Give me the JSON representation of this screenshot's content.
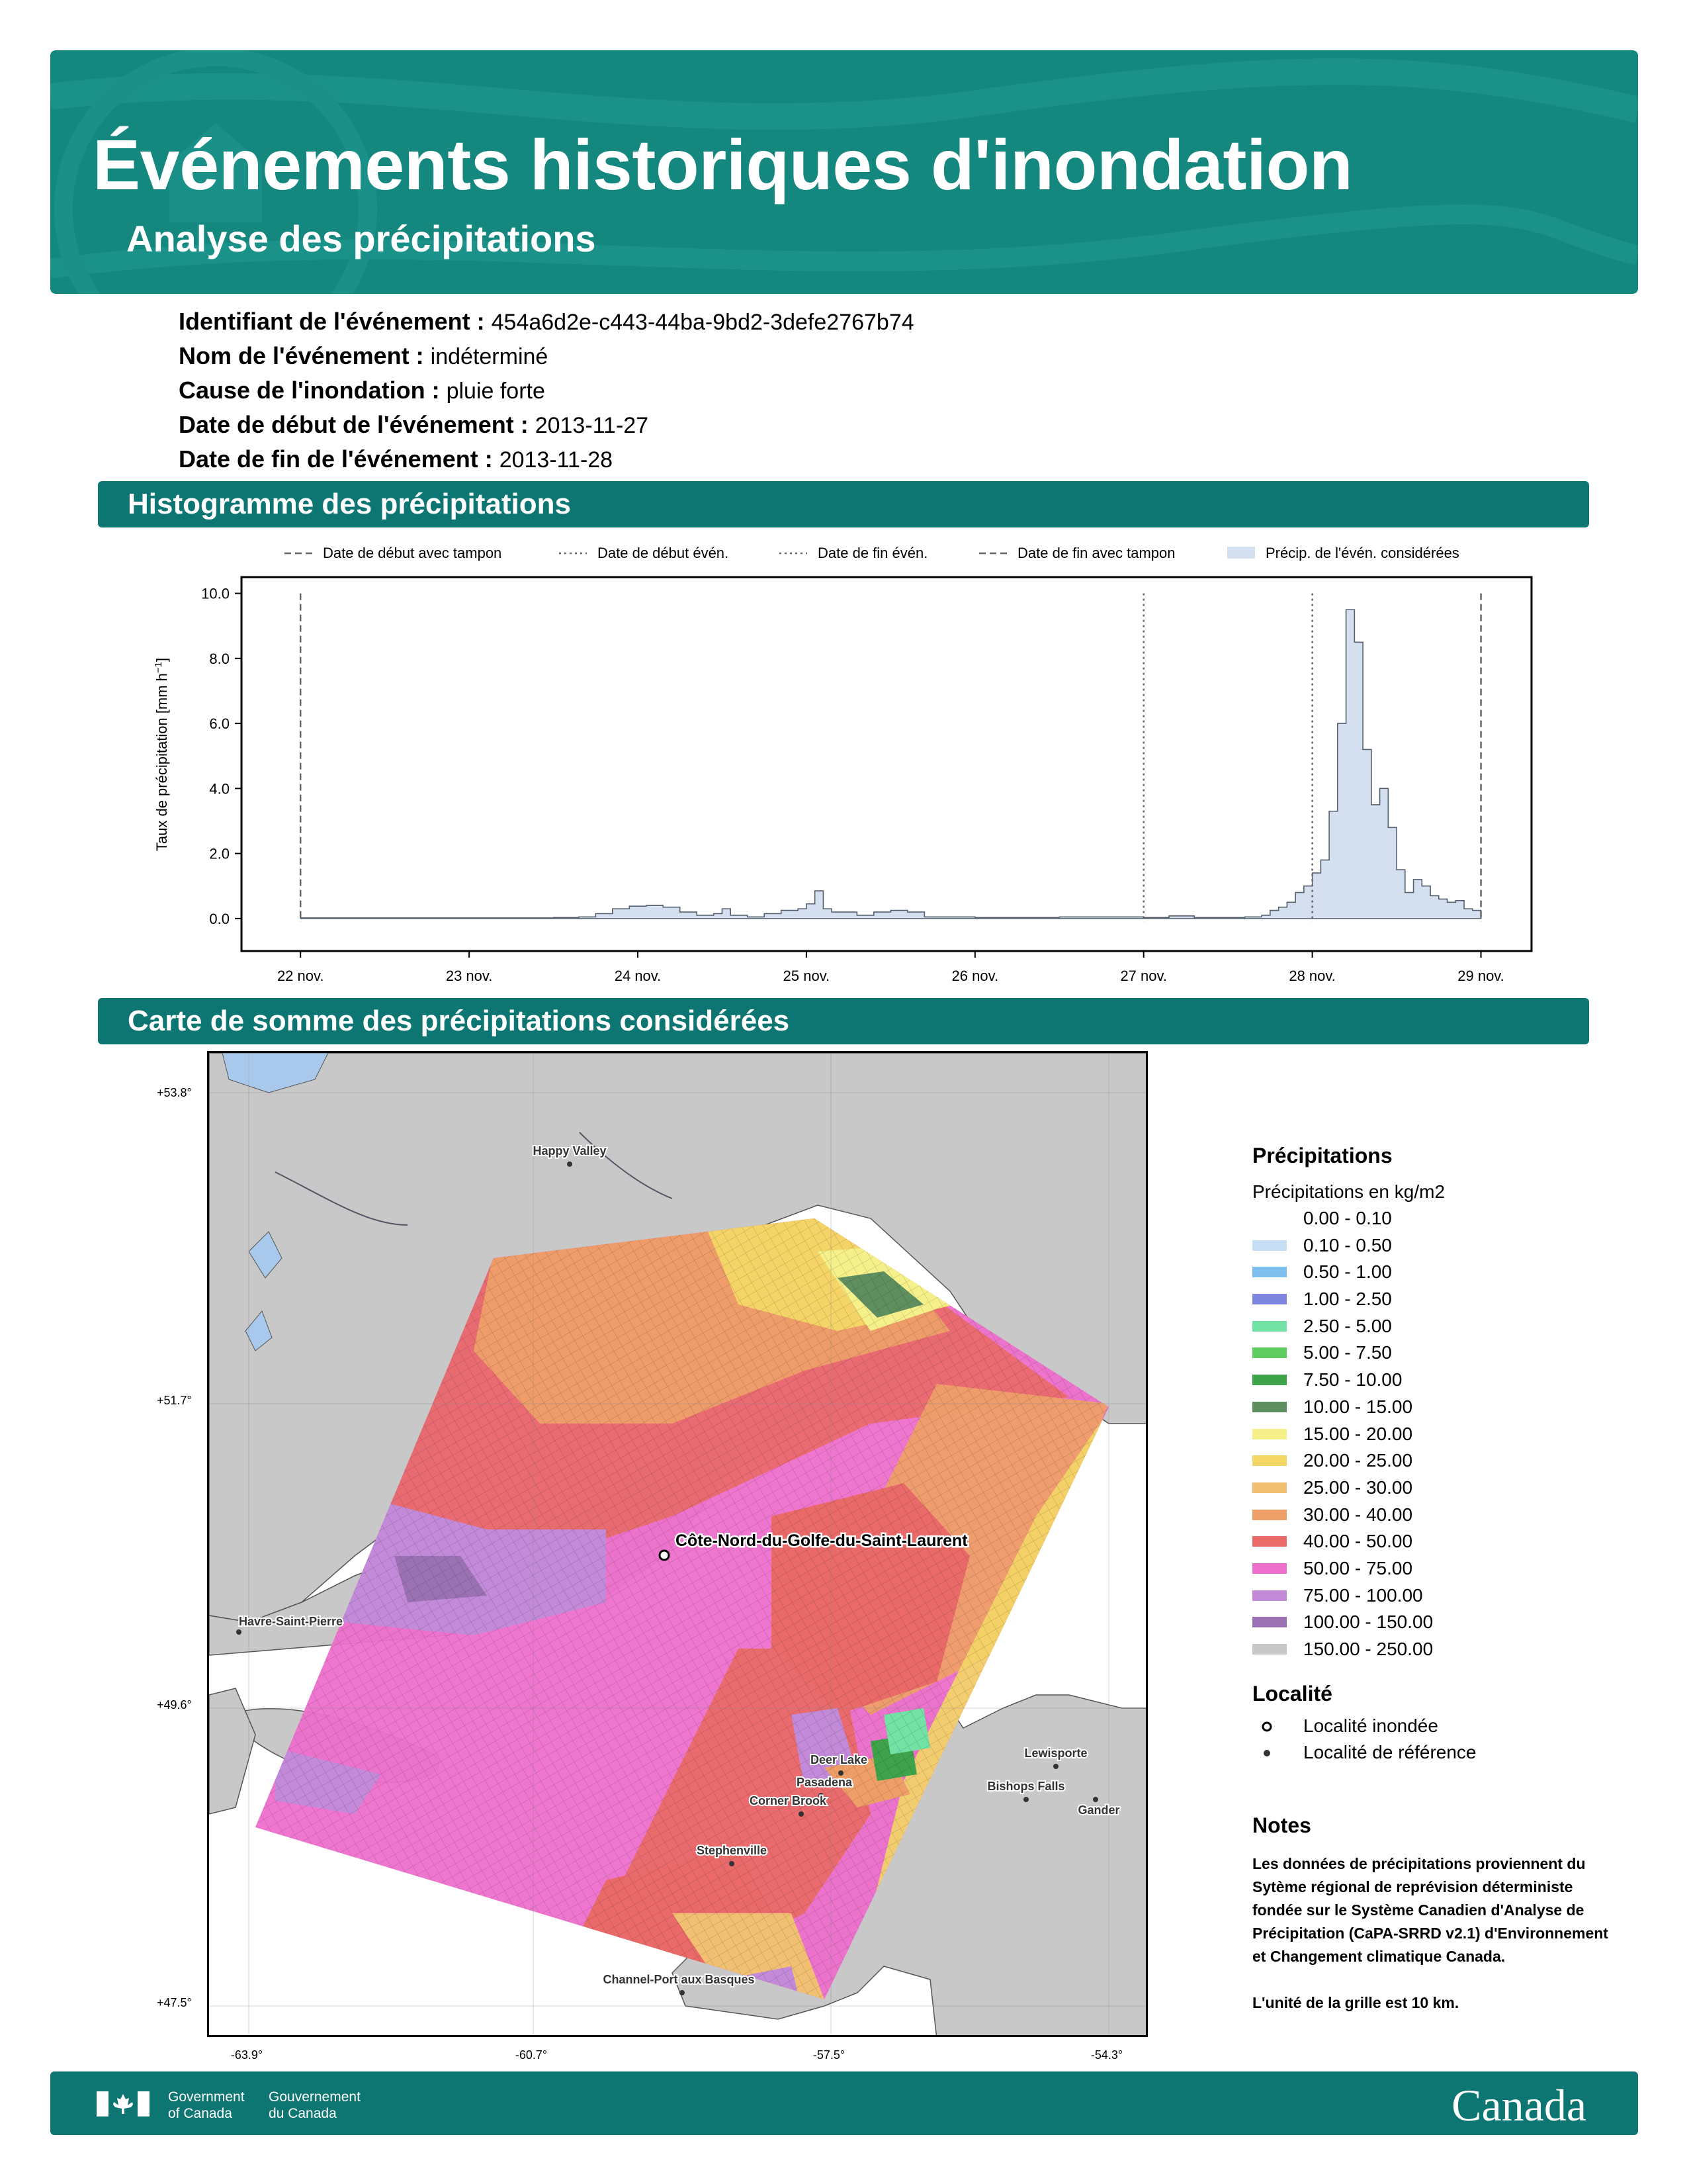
{
  "header": {
    "title": "Événements historiques d'inondation",
    "subtitle": "Analyse des précipitations"
  },
  "event": {
    "id_label": "Identifiant de l'événement :",
    "id_value": "454a6d2e-c443-44ba-9bd2-3defe2767b74",
    "name_label": "Nom de l'événement :",
    "name_value": "indéterminé",
    "cause_label": "Cause de l'inondation :",
    "cause_value": "pluie forte",
    "start_label": "Date de début de l'événement :",
    "start_value": "2013-11-27",
    "end_label": "Date de fin de l'événement :",
    "end_value": "2013-11-28"
  },
  "sections": {
    "histogram": "Histogramme des précipitations",
    "map": "Carte de somme des précipitations considérées"
  },
  "chart_data": {
    "type": "area",
    "ylabel": "Taux de précipitation [mm h",
    "ylabel_sup": "−1",
    "ylabel_end": "]",
    "ylim": [
      -1.0,
      10.5
    ],
    "yticks": [
      0.0,
      2.0,
      4.0,
      6.0,
      8.0,
      10.0
    ],
    "ytick_labels": [
      "0.0",
      "2.0",
      "4.0",
      "6.0",
      "8.0",
      "10.0"
    ],
    "xlim": [
      -0.35,
      7.3
    ],
    "xticks": [
      0,
      1,
      2,
      3,
      4,
      5,
      6,
      7
    ],
    "xtick_labels": [
      "22 nov.",
      "23 nov.",
      "24 nov.",
      "25 nov.",
      "26 nov.",
      "27 nov.",
      "28 nov.",
      "29 nov."
    ],
    "legend_position": "top",
    "legend": [
      {
        "label": "Date de début avec tampon",
        "style": "dashed"
      },
      {
        "label": "Date de début évén.",
        "style": "dotted"
      },
      {
        "label": "Date de fin évén.",
        "style": "dotted"
      },
      {
        "label": "Date de fin avec tampon",
        "style": "dashed"
      },
      {
        "label": "Précip. de l'évén. considérées",
        "style": "fill"
      }
    ],
    "vlines": [
      {
        "x": 0,
        "style": "dashed"
      },
      {
        "x": 5,
        "style": "dotted"
      },
      {
        "x": 6,
        "style": "dotted"
      },
      {
        "x": 7,
        "style": "dashed"
      }
    ],
    "fill_color": "#d4dff0",
    "series": [
      {
        "points": [
          [
            0.0,
            0.02
          ],
          [
            1.0,
            0.02
          ],
          [
            1.5,
            0.03
          ],
          [
            1.65,
            0.05
          ],
          [
            1.75,
            0.15
          ],
          [
            1.85,
            0.3
          ],
          [
            1.95,
            0.38
          ],
          [
            2.05,
            0.4
          ],
          [
            2.15,
            0.35
          ],
          [
            2.25,
            0.2
          ],
          [
            2.35,
            0.1
          ],
          [
            2.45,
            0.15
          ],
          [
            2.5,
            0.3
          ],
          [
            2.55,
            0.1
          ],
          [
            2.65,
            0.05
          ],
          [
            2.75,
            0.15
          ],
          [
            2.85,
            0.25
          ],
          [
            2.95,
            0.3
          ],
          [
            3.0,
            0.45
          ],
          [
            3.05,
            0.85
          ],
          [
            3.1,
            0.3
          ],
          [
            3.15,
            0.2
          ],
          [
            3.25,
            0.2
          ],
          [
            3.3,
            0.1
          ],
          [
            3.4,
            0.2
          ],
          [
            3.5,
            0.25
          ],
          [
            3.6,
            0.2
          ],
          [
            3.7,
            0.05
          ],
          [
            4.0,
            0.03
          ],
          [
            4.5,
            0.05
          ],
          [
            4.8,
            0.05
          ],
          [
            5.0,
            0.03
          ],
          [
            5.15,
            0.08
          ],
          [
            5.3,
            0.03
          ],
          [
            5.6,
            0.05
          ],
          [
            5.7,
            0.1
          ],
          [
            5.75,
            0.25
          ],
          [
            5.8,
            0.35
          ],
          [
            5.85,
            0.5
          ],
          [
            5.9,
            0.8
          ],
          [
            5.95,
            1.0
          ],
          [
            6.0,
            1.4
          ],
          [
            6.05,
            1.8
          ],
          [
            6.1,
            3.3
          ],
          [
            6.15,
            6.0
          ],
          [
            6.2,
            9.5
          ],
          [
            6.25,
            8.5
          ],
          [
            6.3,
            5.2
          ],
          [
            6.35,
            3.5
          ],
          [
            6.4,
            4.0
          ],
          [
            6.45,
            2.8
          ],
          [
            6.5,
            1.5
          ],
          [
            6.55,
            0.8
          ],
          [
            6.6,
            1.2
          ],
          [
            6.65,
            1.0
          ],
          [
            6.7,
            0.7
          ],
          [
            6.75,
            0.6
          ],
          [
            6.8,
            0.5
          ],
          [
            6.85,
            0.55
          ],
          [
            6.9,
            0.3
          ],
          [
            6.95,
            0.25
          ],
          [
            7.0,
            0.05
          ]
        ]
      }
    ]
  },
  "map": {
    "lat_labels": [
      "+53.8°",
      "+51.7°",
      "+49.6°",
      "+47.5°"
    ],
    "lon_labels": [
      "-63.9°",
      "-60.7°",
      "-57.5°",
      "-54.3°"
    ],
    "towns": [
      "Happy Valley",
      "Havre-Saint-Pierre",
      "Deer Lake",
      "Pasadena",
      "Corner Brook",
      "Stephenville",
      "Channel-Port aux Basques",
      "Lewisporte",
      "Bishops Falls",
      "Gander"
    ],
    "flooded_town": "Côte-Nord-du-Golfe-du-Saint-Laurent"
  },
  "legend": {
    "title": "Précipitations",
    "subtitle": "Précipitations en kg/m2",
    "items": [
      {
        "label": "0.00 - 0.10",
        "color": "#ffffff"
      },
      {
        "label": "0.10 - 0.50",
        "color": "#c6dff5"
      },
      {
        "label": "0.50 - 1.00",
        "color": "#7fbfee"
      },
      {
        "label": "1.00 - 2.50",
        "color": "#7f86e0"
      },
      {
        "label": "2.50 - 5.00",
        "color": "#72e3a4"
      },
      {
        "label": "5.00 - 7.50",
        "color": "#5fcc5f"
      },
      {
        "label": "7.50 - 10.00",
        "color": "#3ea34a"
      },
      {
        "label": "10.00 - 15.00",
        "color": "#5f8f5f"
      },
      {
        "label": "15.00 - 20.00",
        "color": "#f5f08a"
      },
      {
        "label": "20.00 - 25.00",
        "color": "#f3d766"
      },
      {
        "label": "25.00 - 30.00",
        "color": "#f2c072"
      },
      {
        "label": "30.00 - 40.00",
        "color": "#ee9f68"
      },
      {
        "label": "40.00 - 50.00",
        "color": "#e96a68"
      },
      {
        "label": "50.00 - 75.00",
        "color": "#ee6fcb"
      },
      {
        "label": "75.00 - 100.00",
        "color": "#c28ad8"
      },
      {
        "label": "100.00 - 150.00",
        "color": "#9a72b4"
      },
      {
        "label": "150.00 - 250.00",
        "color": "#c8c8c8"
      }
    ],
    "loc_title": "Localité",
    "loc_flooded": "Localité inondée",
    "loc_reference": "Localité de référence"
  },
  "notes": {
    "title": "Notes",
    "body": "Les données de précipitations proviennent du Sytème régional de reprévision déterministe fondée sur le Système Canadien d'Analyse de Précipitation (CaPA-SRRD v2.1) d'Environnement et Changement climatique Canada.",
    "grid": "L'unité de la grille est 10 km."
  },
  "footer": {
    "gov_en_1": "Government",
    "gov_en_2": "of Canada",
    "gov_fr_1": "Gouvernement",
    "gov_fr_2": "du Canada",
    "wordmark": "Canada"
  },
  "colors": {
    "header": "#14877f",
    "band": "#0e7672",
    "land": "#c8c8c8",
    "water": "#ffffff",
    "lake": "#a9c9ec"
  }
}
